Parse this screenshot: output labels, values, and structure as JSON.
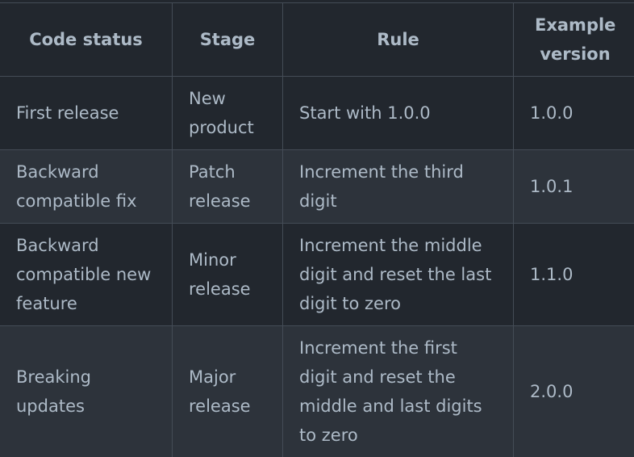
{
  "headers": [
    "Code status",
    "Stage",
    "Rule",
    "Example version"
  ],
  "rows": [
    {
      "status": "First release",
      "stage": "New product",
      "rule": "Start with 1.0.0",
      "example": "1.0.0"
    },
    {
      "status": "Backward compatible fix",
      "stage": "Patch release",
      "rule": "Increment the third digit",
      "example": "1.0.1"
    },
    {
      "status": "Backward compatible new feature",
      "stage": "Minor release",
      "rule": "Increment the middle digit and reset the last digit to zero",
      "example": "1.1.0"
    },
    {
      "status": "Breaking updates",
      "stage": "Major release",
      "rule": "Increment the first digit and reset the middle and last digits to zero",
      "example": "2.0.0"
    }
  ]
}
